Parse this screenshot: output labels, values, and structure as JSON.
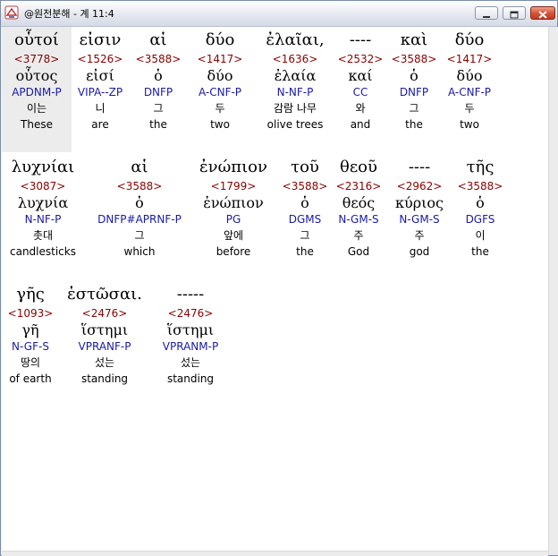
{
  "window": {
    "title": "@원전분해 - 계 11:4"
  },
  "rows": [
    [
      {
        "greek": "οὗτοί",
        "strong": "<3778>",
        "lemma": "οὗτος",
        "parse": "APDNM-P",
        "korean": "이는",
        "english": "These"
      },
      {
        "greek": "εἰσιν",
        "strong": "<1526>",
        "lemma": "εἰσί",
        "parse": "VIPA--ZP",
        "korean": "니",
        "english": "are"
      },
      {
        "greek": "αἱ",
        "strong": "<3588>",
        "lemma": "ὁ",
        "parse": "DNFP",
        "korean": "그",
        "english": "the"
      },
      {
        "greek": "δύο",
        "strong": "<1417>",
        "lemma": "δύο",
        "parse": "A-CNF-P",
        "korean": "두",
        "english": "two"
      },
      {
        "greek": "ἐλαῖαι,",
        "strong": "<1636>",
        "lemma": "ἐλαία",
        "parse": "N-NF-P",
        "korean": "감람 나무",
        "english": "olive trees"
      },
      {
        "greek": "----",
        "strong": "<2532>",
        "lemma": "καί",
        "parse": "CC",
        "korean": "와",
        "english": "and"
      },
      {
        "greek": "καὶ",
        "strong": "<3588>",
        "lemma": "ὁ",
        "parse": "DNFP",
        "korean": "그",
        "english": "the"
      },
      {
        "greek": "δύο",
        "strong": "<1417>",
        "lemma": "δύο",
        "parse": "A-CNF-P",
        "korean": "두",
        "english": "two"
      }
    ],
    [
      {
        "greek": "λυχνίαι",
        "strong": "<3087>",
        "lemma": "λυχνία",
        "parse": "N-NF-P",
        "korean": "촛대",
        "english": "candlesticks"
      },
      {
        "greek": "αἱ",
        "strong": "<3588>",
        "lemma": "ὁ",
        "parse": "DNFP#APRNF-P",
        "korean": "그",
        "english": "which"
      },
      {
        "greek": "ἐνώπιον",
        "strong": "<1799>",
        "lemma": "ἐνώπιον",
        "parse": "PG",
        "korean": "앞에",
        "english": "before"
      },
      {
        "greek": "τοῦ",
        "strong": "<3588>",
        "lemma": "ὁ",
        "parse": "DGMS",
        "korean": "그",
        "english": "the"
      },
      {
        "greek": "θεοῦ",
        "strong": "<2316>",
        "lemma": "θεός",
        "parse": "N-GM-S",
        "korean": "주",
        "english": "God"
      },
      {
        "greek": "----",
        "strong": "<2962>",
        "lemma": "κύριος",
        "parse": "N-GM-S",
        "korean": "주",
        "english": "god"
      },
      {
        "greek": "τῆς",
        "strong": "<3588>",
        "lemma": "ὁ",
        "parse": "DGFS",
        "korean": "이",
        "english": "the"
      }
    ],
    [
      {
        "greek": "γῆς",
        "strong": "<1093>",
        "lemma": "γῆ",
        "parse": "N-GF-S",
        "korean": "땅의",
        "english": "of earth"
      },
      {
        "greek": "ἑστῶσαι.",
        "strong": "<2476>",
        "lemma": "ἵστημι",
        "parse": "VPRANF-P",
        "korean": "섰는",
        "english": "standing"
      },
      {
        "greek": "-----",
        "strong": "<2476>",
        "lemma": "ἵστημι",
        "parse": "VPRANM-P",
        "korean": "섰는",
        "english": "standing"
      }
    ]
  ]
}
